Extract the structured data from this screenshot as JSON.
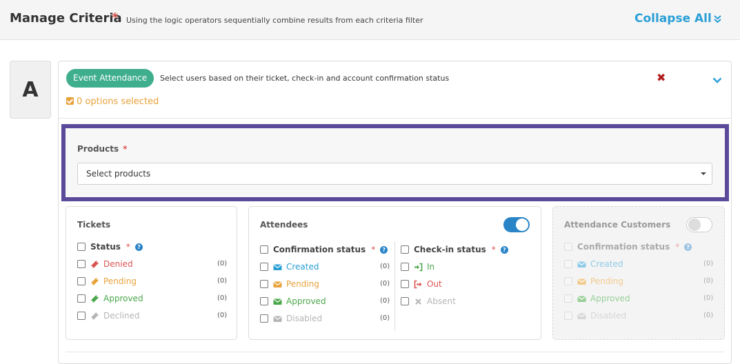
{
  "header": {
    "title": "Manage Criteria",
    "required": "*",
    "subtitle": "Using the logic operators sequentially combine results from each criteria filter",
    "collapse_all": "Collapse All"
  },
  "criteria": {
    "letter": "A",
    "type_label": "Event Attendance",
    "description": "Select users based on their ticket, check-in and account confirmation status",
    "options_selected": "0 options selected"
  },
  "products": {
    "label": "Products",
    "required": "*",
    "placeholder": "Select products"
  },
  "tickets": {
    "title": "Tickets",
    "status_heading": "Status",
    "required": "*",
    "items": [
      {
        "label": "Denied",
        "count": "(0)",
        "color": "#d9534f",
        "icon": "ticket-icon"
      },
      {
        "label": "Pending",
        "count": "(0)",
        "color": "#e8a23c",
        "icon": "ticket-icon"
      },
      {
        "label": "Approved",
        "count": "(0)",
        "color": "#4aa64a",
        "icon": "ticket-icon"
      },
      {
        "label": "Declined",
        "count": "(0)",
        "color": "#b5b5b5",
        "icon": "ticket-icon"
      }
    ]
  },
  "attendees": {
    "title": "Attendees",
    "toggle_on": true,
    "confirmation_heading": "Confirmation status",
    "checkin_heading": "Check-in status",
    "required": "*",
    "confirmation_items": [
      {
        "label": "Created",
        "count": "(0)",
        "color": "#2a9fd6",
        "icon": "envelope-icon"
      },
      {
        "label": "Pending",
        "count": "(0)",
        "color": "#e8a23c",
        "icon": "envelope-icon"
      },
      {
        "label": "Approved",
        "count": "(0)",
        "color": "#4aa64a",
        "icon": "envelope-icon"
      },
      {
        "label": "Disabled",
        "count": "(0)",
        "color": "#b5b5b5",
        "icon": "envelope-icon"
      }
    ],
    "checkin_items": [
      {
        "label": "In",
        "color": "#4aa64a",
        "icon": "sign-in-icon"
      },
      {
        "label": "Out",
        "color": "#d9534f",
        "icon": "sign-out-icon"
      },
      {
        "label": "Absent",
        "color": "#b5b5b5",
        "icon": "times-icon"
      }
    ]
  },
  "attendance_customers": {
    "title": "Attendance Customers",
    "toggle_on": false,
    "confirmation_heading": "Confirmation status",
    "required": "*",
    "items": [
      {
        "label": "Created",
        "count": "(0)",
        "color": "#8fcbe8",
        "icon": "envelope-icon"
      },
      {
        "label": "Pending",
        "count": "(0)",
        "color": "#f2c98c",
        "icon": "envelope-icon"
      },
      {
        "label": "Approved",
        "count": "(0)",
        "color": "#98cf98",
        "icon": "envelope-icon"
      },
      {
        "label": "Disabled",
        "count": "(0)",
        "color": "#d6d6d6",
        "icon": "envelope-icon"
      }
    ]
  }
}
